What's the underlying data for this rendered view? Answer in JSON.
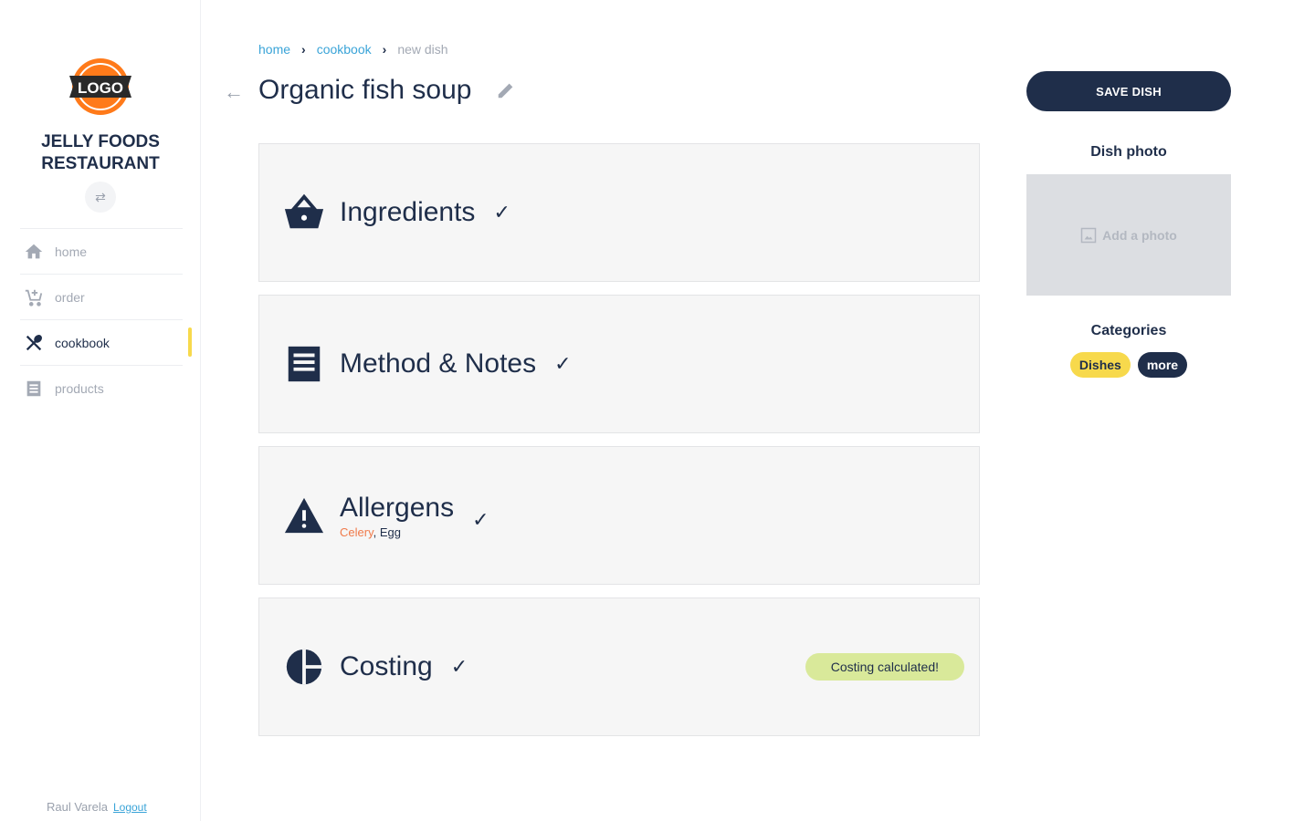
{
  "sidebar": {
    "logo_text": "LOGO",
    "brand_line1": "JELLY FOODS",
    "brand_line2": "RESTAURANT",
    "items": [
      {
        "label": "home",
        "icon": "home-icon"
      },
      {
        "label": "order",
        "icon": "cart-add-icon"
      },
      {
        "label": "cookbook",
        "icon": "utensils-icon",
        "active": true
      },
      {
        "label": "products",
        "icon": "receipt-icon"
      }
    ],
    "user": "Raul Varela",
    "logout": "Logout"
  },
  "breadcrumb": [
    "home",
    "cookbook",
    "new dish"
  ],
  "page": {
    "title": "Organic fish soup"
  },
  "sections": [
    {
      "title": "Ingredients",
      "icon": "basket-icon",
      "done": true
    },
    {
      "title": "Method & Notes",
      "icon": "receipt-icon",
      "done": true
    },
    {
      "title": "Allergens",
      "icon": "warning-icon",
      "done": true,
      "allergens": [
        "Celery",
        "Egg"
      ]
    },
    {
      "title": "Costing",
      "icon": "pie-chart-icon",
      "done": true,
      "badge": "Costing calculated!"
    }
  ],
  "right": {
    "save_label": "SAVE DISH",
    "photo_heading": "Dish photo",
    "photo_placeholder": "Add a photo",
    "categories_heading": "Categories",
    "categories": [
      "Dishes"
    ],
    "more_label": "more"
  },
  "colors": {
    "primary": "#1f2e4a",
    "accent": "#f7d94c",
    "link": "#3aa4d8",
    "success": "#d9e99a",
    "allergen": "#f07a4a"
  }
}
